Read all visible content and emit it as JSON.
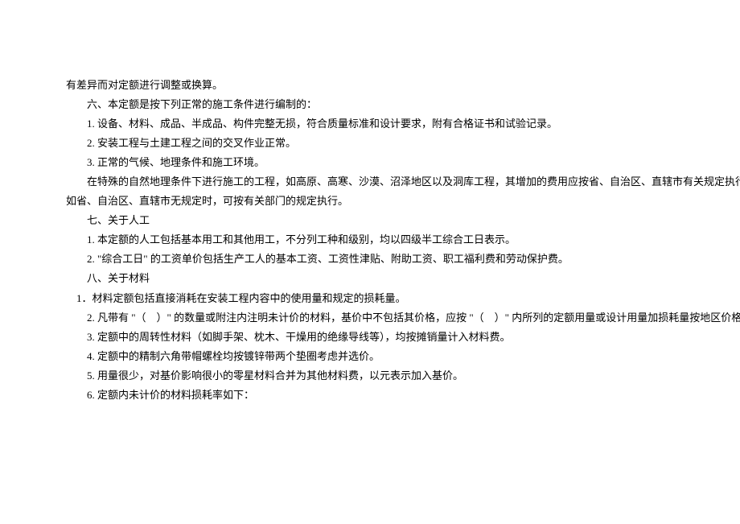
{
  "lines": [
    "有差异而对定额进行调整或换算。",
    "　　六、本定额是按下列正常的施工条件进行编制的：",
    "　　1. 设备、材料、成品、半成品、构件完整无损，符合质量标准和设计要求，附有合格证书和试验记录。",
    "　　2. 安装工程与土建工程之间的交叉作业正常。",
    "　　3. 正常的气候、地理条件和施工环境。",
    "　　在特殊的自然地理条件下进行施工的工程，如高原、高寒、沙漠、沼泽地区以及洞库工程，其增加的费用应按省、自治区、直辖市有关规定执行；",
    "如省、自治区、直辖市无规定时，可按有关部门的规定执行。",
    "　　七、关于人工",
    "　　1. 本定额的人工包括基本用工和其他用工，不分列工种和级别，均以四级半工综合工日表示。",
    "　　2. \"综合工日\" 的工资单价包括生产工人的基本工资、工资性津贴、附助工资、职工福利费和劳动保护费。",
    "　　八、关于材料",
    "　1．材料定额包括直接消耗在安装工程内容中的使用量和规定的损耗量。",
    "　　2. 凡带有 \"（　）\" 的数量或附注内注明未计价的材料，基价中不包括其价格，应按 \"（　）\" 内所列的定额用量或设计用量加损耗量按地区价格计算。",
    "　　3. 定额中的周转性材料（如脚手架、枕木、干燥用的绝缘导线等），均按摊销量计入材料费。",
    "　　4. 定额中的精制六角带帽螺栓均按镀锌带两个垫圈考虑并选价。",
    "　　5. 用量很少，对基价影响很小的零星材料合并为其他材料费，以元表示加入基价。",
    "　　6. 定额内未计价的材料损耗率如下："
  ]
}
